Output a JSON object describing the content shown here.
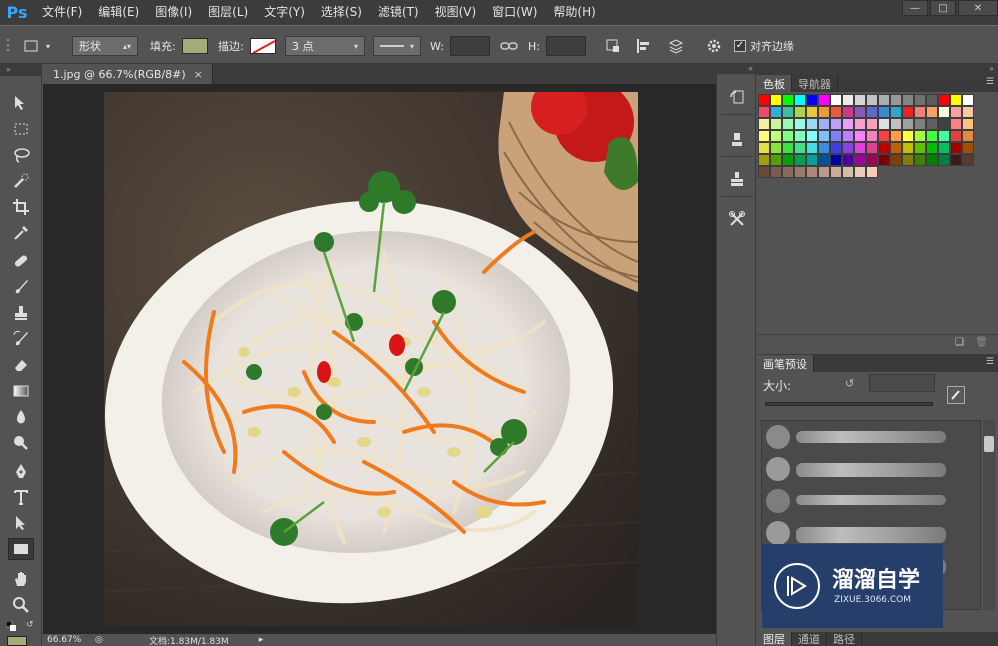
{
  "app": {
    "logo": "Ps",
    "menu": [
      "文件(F)",
      "编辑(E)",
      "图像(I)",
      "图层(L)",
      "文字(Y)",
      "选择(S)",
      "滤镜(T)",
      "视图(V)",
      "窗口(W)",
      "帮助(H)"
    ],
    "window_controls": [
      "minimize-icon",
      "restore-icon",
      "close-icon"
    ]
  },
  "options": {
    "shape_mode": "形状",
    "fill_label": "填充:",
    "fill_color": "#a6ab7a",
    "stroke_label": "描边:",
    "stroke_size": "3 点",
    "w_label": "W:",
    "h_label": "H:",
    "align_edges_label": "对齐边缘",
    "align_edges_checked": true
  },
  "document": {
    "tab_title": "1.jpg @ 66.7%(RGB/8#)",
    "tab_close": "×",
    "zoom": "66.67%",
    "doc_size": "文档:1.83M/1.83M"
  },
  "panels": {
    "swatches_tabs": [
      "色板",
      "导航器"
    ],
    "brush_tab": "画笔预设",
    "brush_size_label": "大小:",
    "bottom_tabs": [
      "图层",
      "通道",
      "路径"
    ]
  },
  "swatches": [
    "#ff0000",
    "#ffff00",
    "#00ff00",
    "#00ffff",
    "#0000ff",
    "#ff00ff",
    "#ffffff",
    "#ebebeb",
    "#d6d6d6",
    "#c2c2c2",
    "#adadad",
    "#999999",
    "#858585",
    "#707070",
    "#5c5c5c",
    "#ff0000",
    "#ffff00",
    "#ffffff",
    "#ee4b6b",
    "#2fb0d6",
    "#3ec0a0",
    "#b0d14a",
    "#e9c93b",
    "#f59a34",
    "#e85a3a",
    "#d0378a",
    "#8a5ab8",
    "#5a6ad0",
    "#3a8ad8",
    "#2aa8d0",
    "#ee2020",
    "#f08080",
    "#f4a460",
    "#ffffe0",
    "#f7a0a0",
    "#f7c9a0",
    "#f7f0a0",
    "#c9f7a0",
    "#a0f7b0",
    "#a0f7e6",
    "#a0d8f7",
    "#a0b0f7",
    "#c0a0f7",
    "#e6a0f7",
    "#f7a0d8",
    "#f7a0b8",
    "#e0e0e0",
    "#c0c0c0",
    "#a0a0a0",
    "#808080",
    "#606060",
    "#404040",
    "#ff8080",
    "#ffbf80",
    "#ffff80",
    "#bfff80",
    "#80ff80",
    "#80ffbf",
    "#80ffff",
    "#80bfff",
    "#8080ff",
    "#bf80ff",
    "#ff80ff",
    "#ff80bf",
    "#ff4040",
    "#ff9f40",
    "#ffff40",
    "#9fff40",
    "#40ff40",
    "#40ff9f",
    "#e04040",
    "#e08c40",
    "#e0e040",
    "#8ce040",
    "#40e040",
    "#40e08c",
    "#40e0e0",
    "#408ce0",
    "#4040e0",
    "#8c40e0",
    "#e040e0",
    "#e0408c",
    "#c00000",
    "#c06000",
    "#c0c000",
    "#60c000",
    "#00c000",
    "#00c060",
    "#a00000",
    "#a05000",
    "#a0a000",
    "#50a000",
    "#00a000",
    "#00a050",
    "#00a0a0",
    "#0050a0",
    "#0000a0",
    "#5000a0",
    "#a000a0",
    "#a00050",
    "#800000",
    "#804000",
    "#808000",
    "#408000",
    "#008000",
    "#008040",
    "#3a1a1a",
    "#5a3a2a",
    "#6a4a3a",
    "#7a5a4a",
    "#8a6a5a",
    "#9a7a6a",
    "#aa8a7a",
    "#ba9a8a",
    "#caaa9a",
    "#dabaaa",
    "#eacaba",
    "#facaba"
  ]
}
